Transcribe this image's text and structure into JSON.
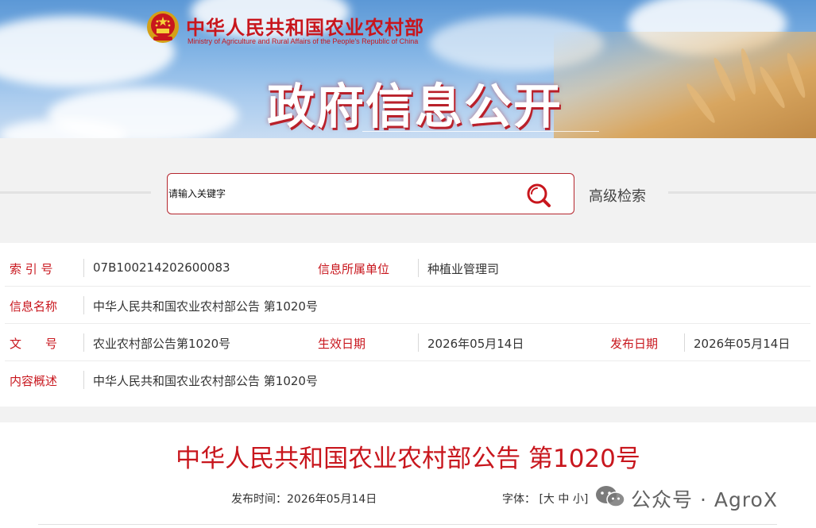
{
  "header": {
    "ministry_name_cn": "中华人民共和国农业农村部",
    "ministry_name_en": "Ministry of Agriculture and Rural Affairs of the People's Republic of China",
    "banner_title": "政府信息公开"
  },
  "search": {
    "placeholder": "请输入关键字",
    "advanced_label": "高级检索"
  },
  "meta": {
    "index_no_label": "索 引 号",
    "index_no_value": "07B100214202600083",
    "dept_label": "信息所属单位",
    "dept_value": "种植业管理司",
    "name_label": "信息名称",
    "name_value": "中华人民共和国农业农村部公告 第1020号",
    "doc_no_label": "文　　号",
    "doc_no_value": "农业农村部公告第1020号",
    "effective_label": "生效日期",
    "effective_value": "2026年05月14日",
    "publish_label": "发布日期",
    "publish_value": "2026年05月14日",
    "summary_label": "内容概述",
    "summary_value": "中华人民共和国农业农村部公告 第1020号"
  },
  "article": {
    "title": "中华人民共和国农业农村部公告 第1020号",
    "pub_time_label": "发布时间：",
    "pub_time_value": "2026年05月14日",
    "font_label": "字体：",
    "font_open": "[",
    "font_large": "大",
    "font_medium": "中",
    "font_small": "小",
    "font_close": "]"
  },
  "watermark": {
    "text": "公众号 · AgroX"
  },
  "colors": {
    "accent_red": "#c8161d",
    "search_border": "#b5262e"
  }
}
